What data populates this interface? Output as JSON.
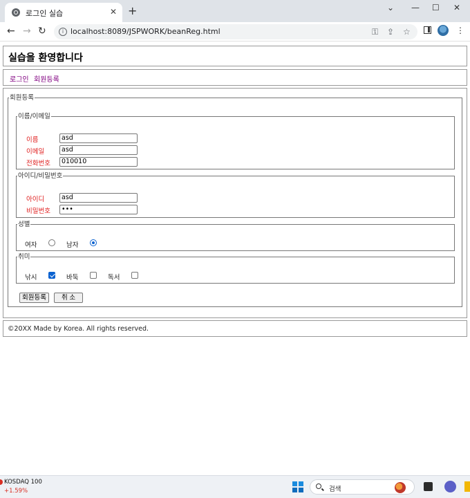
{
  "browser": {
    "tab_title": "로그인 실습",
    "tab_close": "✕",
    "new_tab": "+",
    "url": "localhost:8089/JSPWORK/beanReg.html",
    "window_controls": {
      "chevron": "⌄",
      "minimize": "—",
      "maximize": "☐",
      "close": "✕"
    }
  },
  "page": {
    "heading": "실습을 환영합니다",
    "nav": {
      "login": "로그인",
      "register": "회원등록"
    },
    "form": {
      "legend": "회원등록",
      "section_name": {
        "legend": "이름/이메일",
        "name_label": "이름",
        "name_value": "asd",
        "email_label": "이메일",
        "email_value": "asd",
        "phone_label": "전화번호",
        "phone_value": "010010"
      },
      "section_account": {
        "legend": "아이디/비밀번호",
        "id_label": "아이디",
        "id_value": "asd",
        "password_label": "비밀번호",
        "password_value": "•••"
      },
      "section_gender": {
        "legend": "성별",
        "female_label": "여자",
        "female_checked": false,
        "male_label": "남자",
        "male_checked": true
      },
      "section_hobby": {
        "legend": "취미",
        "fishing_label": "낚시",
        "fishing_checked": true,
        "baduk_label": "바둑",
        "baduk_checked": false,
        "reading_label": "독서",
        "reading_checked": false
      },
      "submit_label": "회원등록",
      "cancel_label": "취 소"
    },
    "footer": "©20XX Made by Korea. All rights reserved."
  },
  "taskbar": {
    "stock_name": "KOSDAQ 100",
    "stock_change": "+1.59%",
    "search_placeholder": "검색"
  },
  "colors": {
    "label_red": "#e02020",
    "link_purple": "#800080",
    "accent_blue": "#0b62d0"
  },
  "icons": [
    "globe-icon",
    "back-icon",
    "forward-icon",
    "reload-icon",
    "info-icon",
    "key-icon",
    "share-icon",
    "star-icon",
    "side-panel-icon",
    "profile-icon",
    "menu-icon",
    "windows-logo-icon",
    "search-icon"
  ]
}
